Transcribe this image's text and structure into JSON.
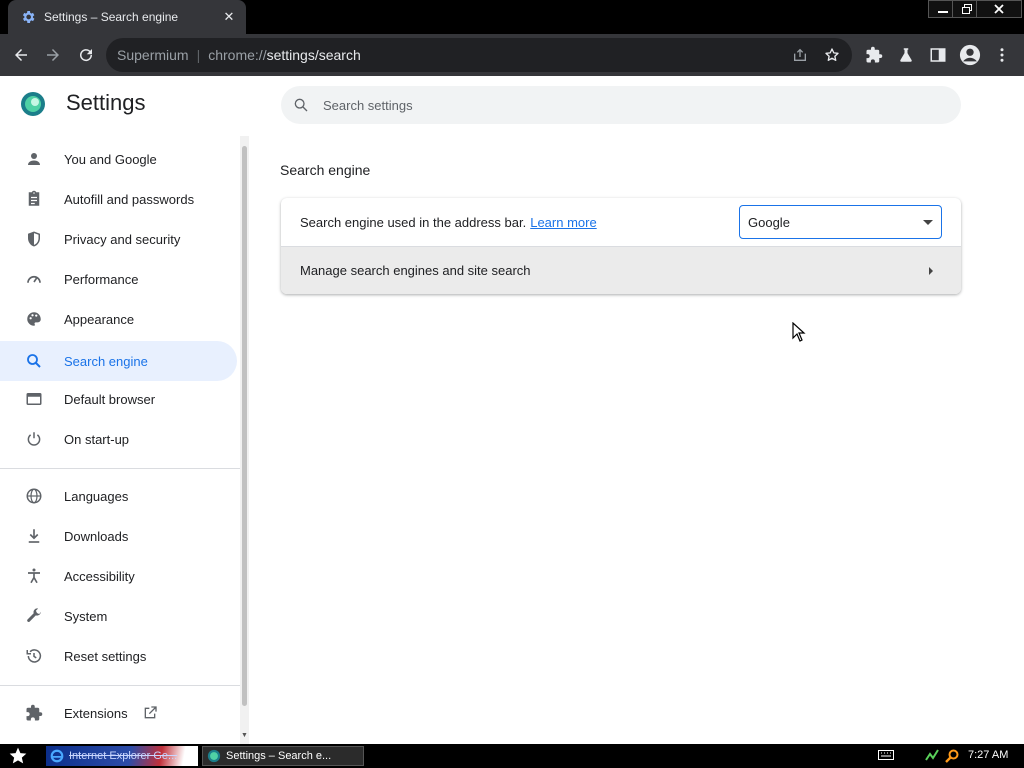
{
  "browser": {
    "tab_title": "Settings – Search engine",
    "omnibox": {
      "site_name": "Supermium",
      "separator": "|",
      "url_scheme": "chrome://",
      "url_path": "settings/search"
    }
  },
  "settings": {
    "app_title": "Settings",
    "search_placeholder": "Search settings",
    "nav_items": [
      {
        "label": "You and Google",
        "icon": "person-icon"
      },
      {
        "label": "Autofill and passwords",
        "icon": "clipboard-icon"
      },
      {
        "label": "Privacy and security",
        "icon": "shield-icon"
      },
      {
        "label": "Performance",
        "icon": "speedometer-icon"
      },
      {
        "label": "Appearance",
        "icon": "palette-icon"
      },
      {
        "label": "Search engine",
        "icon": "search-icon",
        "selected": true
      },
      {
        "label": "Default browser",
        "icon": "browser-window-icon"
      },
      {
        "label": "On start-up",
        "icon": "power-icon"
      },
      {
        "label": "Languages",
        "icon": "globe-icon"
      },
      {
        "label": "Downloads",
        "icon": "download-icon"
      },
      {
        "label": "Accessibility",
        "icon": "accessibility-icon"
      },
      {
        "label": "System",
        "icon": "wrench-icon"
      },
      {
        "label": "Reset settings",
        "icon": "history-icon"
      },
      {
        "label": "Extensions",
        "icon": "puzzle-icon"
      }
    ],
    "section": {
      "title": "Search engine",
      "engine_row_text": "Search engine used in the address bar.",
      "learn_more": "Learn more",
      "selected_engine": "Google",
      "manage_row_text": "Manage search engines and site search"
    }
  },
  "taskbar": {
    "task_ie_label": "Internet Explorer Ge...",
    "task_settings_label": "Settings – Search e...",
    "clock": "7:27 AM"
  },
  "colors": {
    "accent": "#1a73e8",
    "selected_bg": "#e8f0fe",
    "toolbar_bg": "#35363a",
    "omnibox_bg": "#202124"
  }
}
